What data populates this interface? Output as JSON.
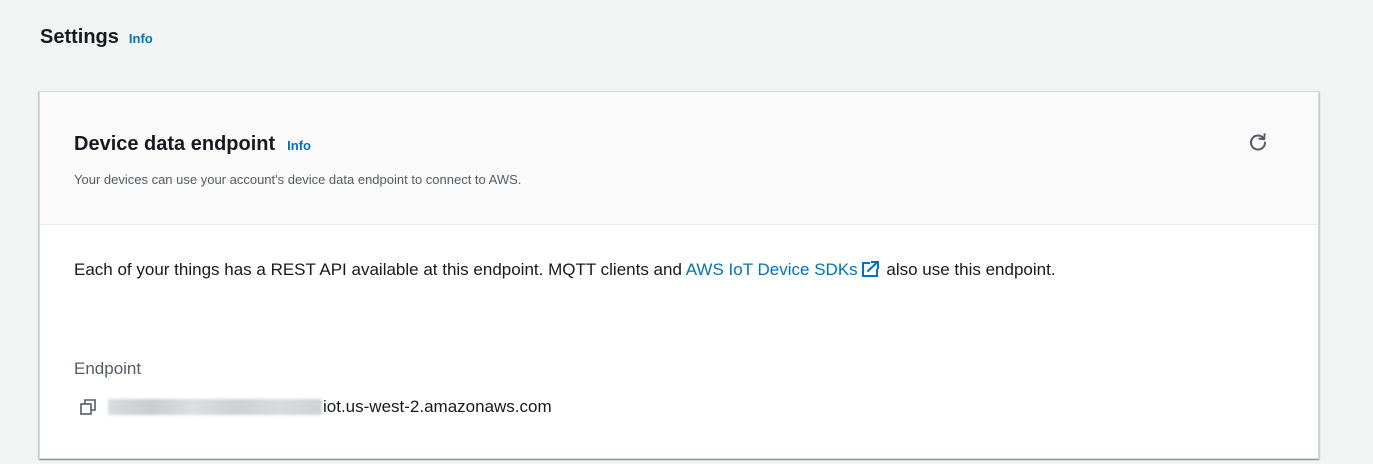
{
  "section": {
    "title": "Settings",
    "info_label": "Info"
  },
  "card": {
    "title": "Device data endpoint",
    "info_label": "Info",
    "description": "Your devices can use your account's device data endpoint to connect to AWS.",
    "body_text_before_link": "Each of your things has a REST API available at this endpoint. MQTT clients and ",
    "link_text": "AWS IoT Device SDKs",
    "body_text_after_link": " also use this endpoint.",
    "endpoint_label": "Endpoint",
    "endpoint_suffix": "iot.us-west-2.amazonaws.com"
  },
  "icons": {
    "refresh": "refresh-icon",
    "external_link": "external-link-icon",
    "copy": "copy-icon"
  },
  "colors": {
    "link": "#0073bb",
    "text": "#16191f",
    "secondary_text": "#545b64",
    "page_bg": "#f2f3f3"
  }
}
